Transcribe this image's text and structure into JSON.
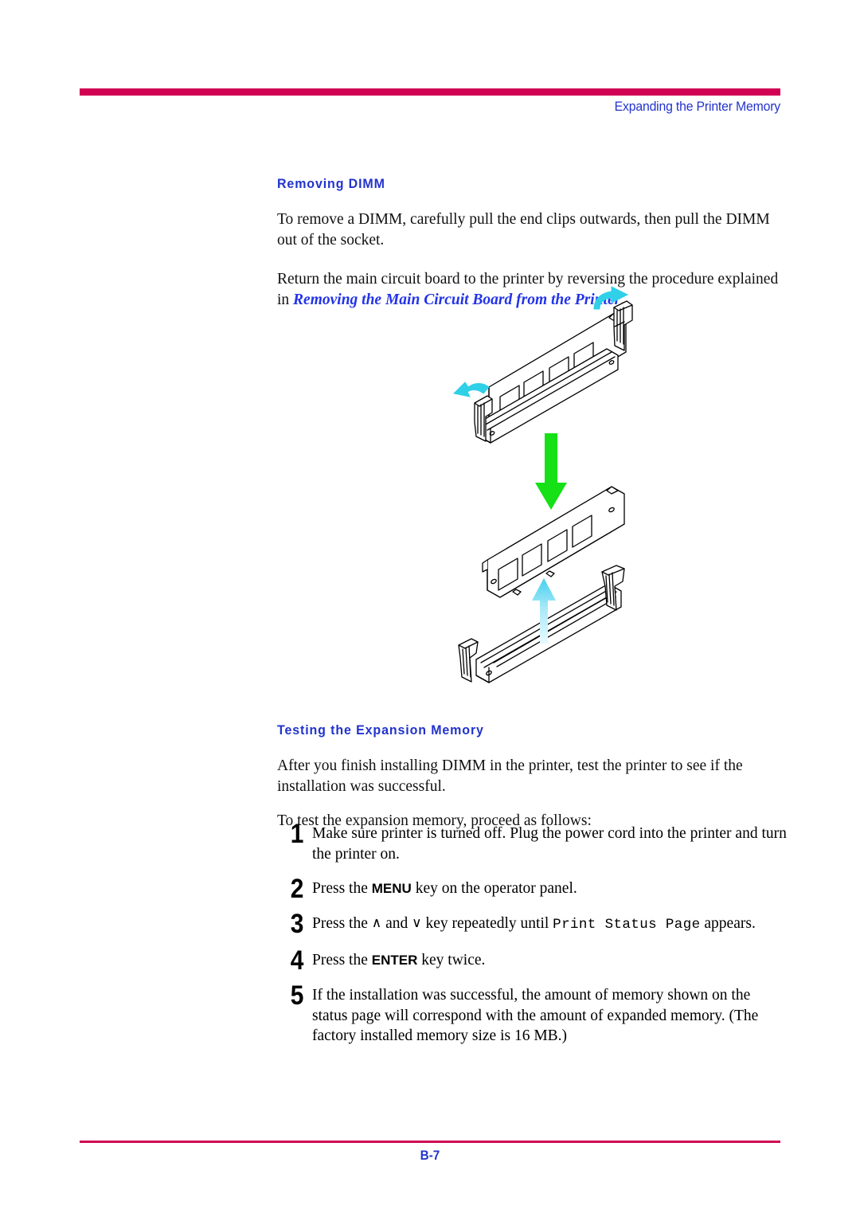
{
  "page": {
    "header_title": "Expanding the Printer Memory",
    "footer_page_number": "B-7",
    "rule_color": "#D10253",
    "heading_color": "#2233CC",
    "link_color": "#2233E8"
  },
  "sections": [
    {
      "heading": "Removing DIMM",
      "paragraphs": [
        "To remove a DIMM, carefully pull the end clips outwards, then pull the DIMM out of the socket.",
        "Return the main circuit board to the printer by reversing the procedure explained in "
      ],
      "xref": "Removing the Main Circuit Board from the Printer",
      "xref_trailing": "."
    },
    {
      "heading": "Testing the Expansion Memory",
      "paragraphs": [
        "After you finish installing DIMM in the printer, test the printer to see if the installation was successful.",
        "To test the expansion memory, proceed as follows:"
      ]
    }
  ],
  "steps": [
    {
      "number": "1",
      "text_full": "Make sure printer is turned off. Plug the power cord into the printer and turn the printer on.",
      "parts": [
        {
          "type": "text",
          "value": "Make sure printer is turned off. Plug the power cord into the printer and turn the printer on."
        }
      ]
    },
    {
      "number": "2",
      "text_full": "Press the MENU key on the operator panel.",
      "parts": [
        {
          "type": "text",
          "value": "Press the "
        },
        {
          "type": "keycap",
          "value": "MENU"
        },
        {
          "type": "text",
          "value": " key on the operator panel."
        }
      ]
    },
    {
      "number": "3",
      "text_full": "Press the ∧ and ∨ key repeatedly until Print Status Page appears.",
      "parts": [
        {
          "type": "text",
          "value": "Press the "
        },
        {
          "type": "chevron",
          "value": "∧"
        },
        {
          "type": "text",
          "value": " and "
        },
        {
          "type": "chevron",
          "value": "∨"
        },
        {
          "type": "text",
          "value": " key repeatedly until "
        },
        {
          "type": "mono",
          "value": "Print Status Page"
        },
        {
          "type": "text",
          "value": " appears."
        }
      ]
    },
    {
      "number": "4",
      "text_full": "Press the ENTER key twice.",
      "parts": [
        {
          "type": "text",
          "value": "Press the "
        },
        {
          "type": "keycap",
          "value": "ENTER"
        },
        {
          "type": "text",
          "value": " key twice."
        }
      ]
    },
    {
      "number": "5",
      "text_full": "If the installation was successful, the amount of memory shown on the status page will correspond with the amount of expanded memory. (The factory installed memory size is 16 MB.)",
      "parts": [
        {
          "type": "text",
          "value": "If the installation was successful, the amount of memory shown on the status page will correspond with the amount of expanded memory. (The factory installed memory size is 16 MB.)"
        }
      ]
    }
  ],
  "figure": {
    "caption": "",
    "description": "DIMM memory module being removed from its socket: end clips pulled outwards, module lifted out",
    "arrow_colors": {
      "clip_arrows": "#22CCDD",
      "insert_arrow": "#00E000",
      "lift_arrow": "#3FD4EE"
    },
    "line_color": "#000000"
  }
}
